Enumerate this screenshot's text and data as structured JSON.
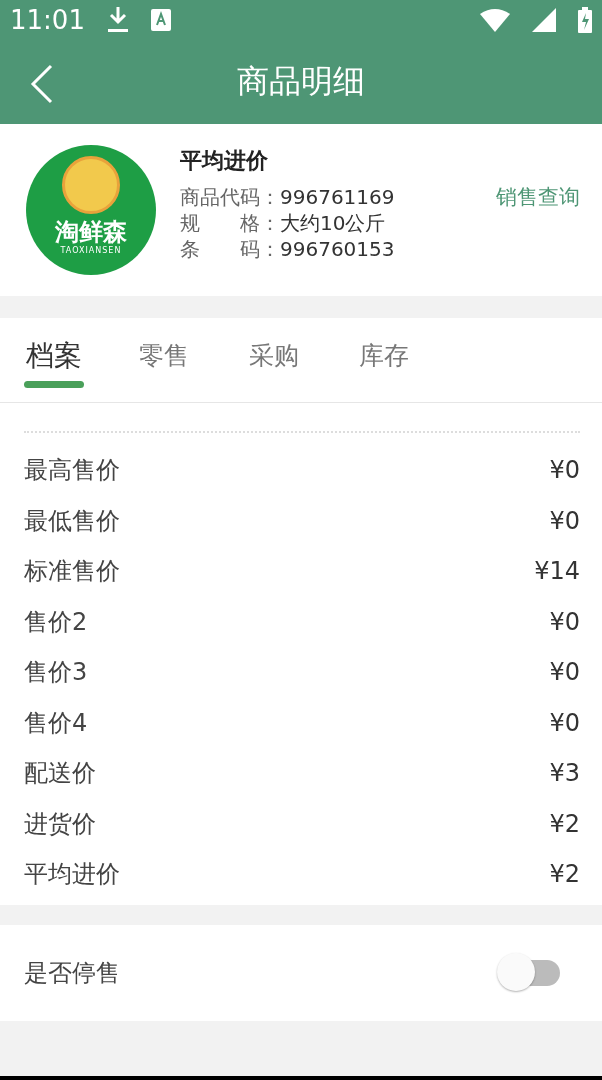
{
  "status_bar": {
    "time": "11:01"
  },
  "header": {
    "title": "商品明细"
  },
  "product": {
    "logo_text": "淘鲜森",
    "logo_subtext": "TAOXIANSEN",
    "name": "平均进价",
    "fields": [
      {
        "label": "商品代码：",
        "value": "996761169"
      },
      {
        "label": "规　　格：",
        "value": "大约10公斤"
      },
      {
        "label": "条　　码：",
        "value": "996760153"
      }
    ],
    "link": "销售查询"
  },
  "tabs": [
    {
      "label": "档案",
      "selected": true
    },
    {
      "label": "零售",
      "selected": false
    },
    {
      "label": "采购",
      "selected": false
    },
    {
      "label": "库存",
      "selected": false
    }
  ],
  "prices": [
    {
      "label": "最高售价",
      "value": "¥0"
    },
    {
      "label": "最低售价",
      "value": "¥0"
    },
    {
      "label": "标准售价",
      "value": "¥14"
    },
    {
      "label": "售价2",
      "value": "¥0"
    },
    {
      "label": "售价3",
      "value": "¥0"
    },
    {
      "label": "售价4",
      "value": "¥0"
    },
    {
      "label": "配送价",
      "value": "¥3"
    },
    {
      "label": "进货价",
      "value": "¥2"
    },
    {
      "label": "平均进价",
      "value": "¥2"
    }
  ],
  "stop_sale": {
    "label": "是否停售",
    "on": false
  }
}
